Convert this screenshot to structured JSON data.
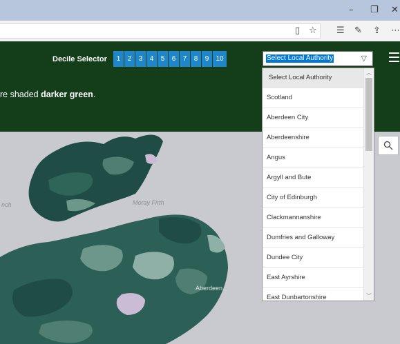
{
  "browser": {
    "minimize_glyph": "–",
    "restore_glyph": "❐",
    "close_glyph": "✕",
    "toolbar_icons": [
      "reading-view-icon",
      "star-icon",
      "favorites-icon",
      "pen-icon",
      "share-icon",
      "more-icon"
    ]
  },
  "header": {
    "decile_label": "Decile Selector",
    "deciles": [
      "1",
      "2",
      "3",
      "4",
      "5",
      "6",
      "7",
      "8",
      "9",
      "10"
    ],
    "selected_authority": "Select Local Authority",
    "instruction_prefix": "re shaded ",
    "instruction_bold": "darker green",
    "instruction_suffix": "."
  },
  "map": {
    "labels": [
      "Moray Firth",
      "nch",
      "Aberdeen"
    ]
  },
  "dropdown": {
    "options": [
      "Select Local Authority",
      "Scotland",
      "Aberdeen City",
      "Aberdeenshire",
      "Angus",
      "Argyll and Bute",
      "City of Edinburgh",
      "Clackmannanshire",
      "Dumfries and Galloway",
      "Dundee City",
      "East Ayrshire",
      "East Dunbartonshire"
    ]
  },
  "colors": {
    "header_bg": "#143d1a",
    "decile_button": "#1f86c9",
    "map_water": "#c8cad0",
    "land_dark": "#1f4d45",
    "land_mid": "#4f7f73",
    "land_light": "#8fb0a6"
  }
}
